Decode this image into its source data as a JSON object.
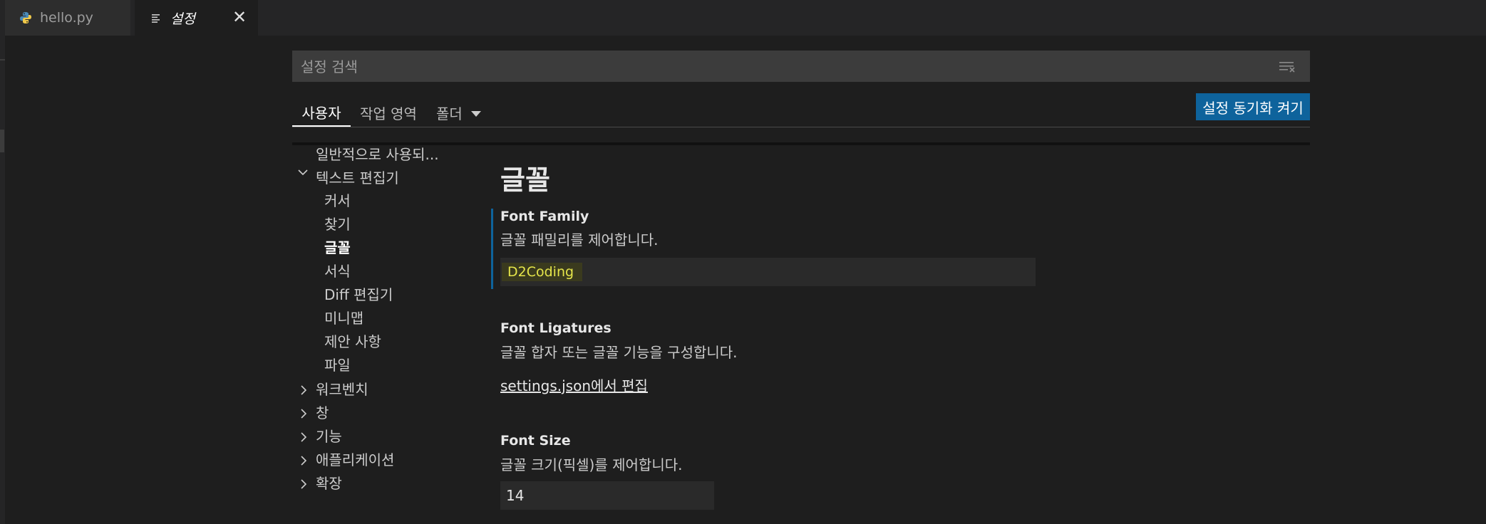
{
  "tabs": [
    {
      "label": "hello.py",
      "icon": "python-icon"
    },
    {
      "label": "설정",
      "icon": "settings-file-icon",
      "close": "✕"
    }
  ],
  "search": {
    "placeholder": "설정 검색",
    "icon": "clear-filter-icon"
  },
  "scope_tabs": {
    "user": "사용자",
    "workspace": "작업 영역",
    "folder": "폴더"
  },
  "sync_button": "설정 동기화 켜기",
  "toc": {
    "commonly_used": "일반적으로 사용되...",
    "text_editor": "텍스트 편집기",
    "text_editor_children": [
      "커서",
      "찾기",
      "글꼴",
      "서식",
      "Diff 편집기",
      "미니맵",
      "제안 사항",
      "파일"
    ],
    "active_item": "글꼴",
    "top_level": [
      "워크벤치",
      "창",
      "기능",
      "애플리케이션",
      "확장"
    ]
  },
  "main": {
    "section_title": "글꼴",
    "font_family": {
      "title": "Font Family",
      "description": "글꼴 패밀리를 제어합니다.",
      "value": "D2Coding"
    },
    "font_ligatures": {
      "title": "Font Ligatures",
      "description": "글꼴 합자 또는 글꼴 기능을 구성합니다.",
      "link": "settings.json에서 편집"
    },
    "font_size": {
      "title": "Font Size",
      "description": "글꼴 크기(픽셀)를 제어합니다.",
      "value": "14"
    }
  },
  "colors": {
    "background": "#1e1e1e",
    "accent": "#0e639c",
    "highlight_text": "#e5e54a"
  }
}
